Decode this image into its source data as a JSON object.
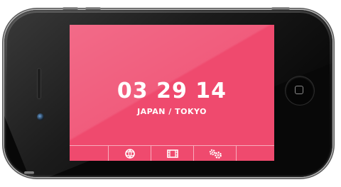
{
  "screen": {
    "clock": "03 29 14",
    "location": "JAPAN / TOKYO",
    "accent_color": "#ef4a6e"
  },
  "tab_bar": {
    "tabs": [
      {
        "icon": "globe-icon"
      },
      {
        "icon": "film-icon"
      },
      {
        "icon": "gears-icon"
      }
    ]
  }
}
